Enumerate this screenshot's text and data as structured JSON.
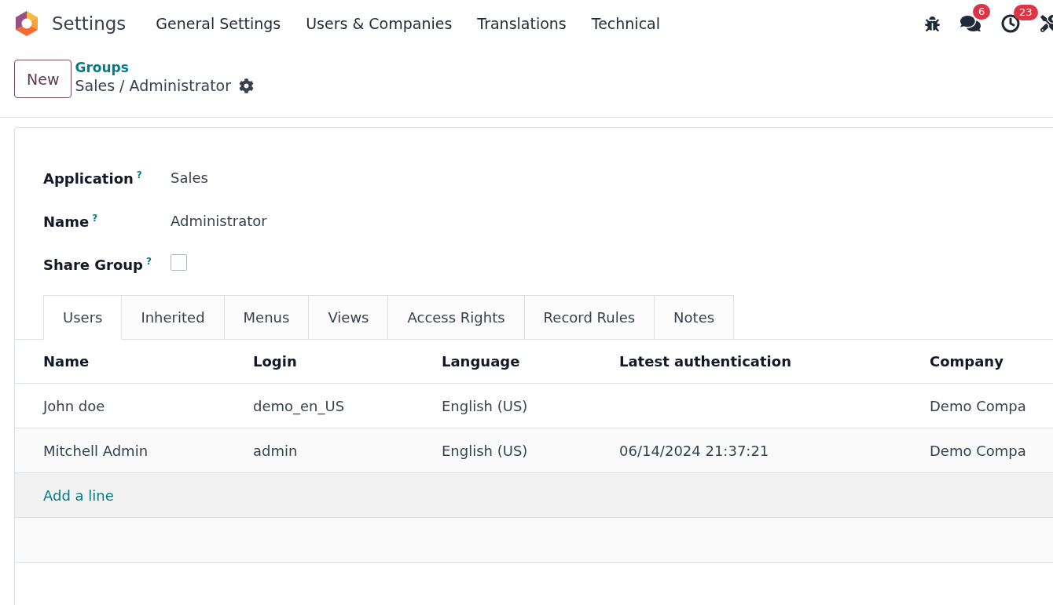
{
  "navbar": {
    "app_name": "Settings",
    "menus": [
      {
        "label": "General Settings"
      },
      {
        "label": "Users & Companies"
      },
      {
        "label": "Translations"
      },
      {
        "label": "Technical"
      }
    ],
    "systray": [
      {
        "kind": "bug"
      },
      {
        "kind": "chat",
        "badge": "6"
      },
      {
        "kind": "clock",
        "badge": "23"
      },
      {
        "kind": "tools"
      }
    ]
  },
  "control_panel": {
    "new_button": "New",
    "breadcrumb": "Groups",
    "record_title": "Sales / Administrator"
  },
  "form": {
    "fields": [
      {
        "label": "Application",
        "help": "?",
        "kind": "text",
        "value": "Sales"
      },
      {
        "label": "Name",
        "help": "?",
        "kind": "text",
        "value": "Administrator"
      },
      {
        "label": "Share Group",
        "help": "?",
        "kind": "checkbox",
        "checked": false
      }
    ],
    "tabs": [
      {
        "label": "Users",
        "selected": true
      },
      {
        "label": "Inherited",
        "selected": false
      },
      {
        "label": "Menus",
        "selected": false
      },
      {
        "label": "Views",
        "selected": false
      },
      {
        "label": "Access Rights",
        "selected": false
      },
      {
        "label": "Record Rules",
        "selected": false
      },
      {
        "label": "Notes",
        "selected": false
      }
    ],
    "table": {
      "columns": [
        "Name",
        "Login",
        "Language",
        "Latest authentication",
        "Company"
      ],
      "rows": [
        [
          "John doe",
          "demo_en_US",
          "English (US)",
          "",
          "Demo Compa"
        ],
        [
          "Mitchell Admin",
          "admin",
          "English (US)",
          "06/14/2024 21:37:21",
          "Demo Compa"
        ]
      ],
      "add_line": "Add a line"
    }
  }
}
